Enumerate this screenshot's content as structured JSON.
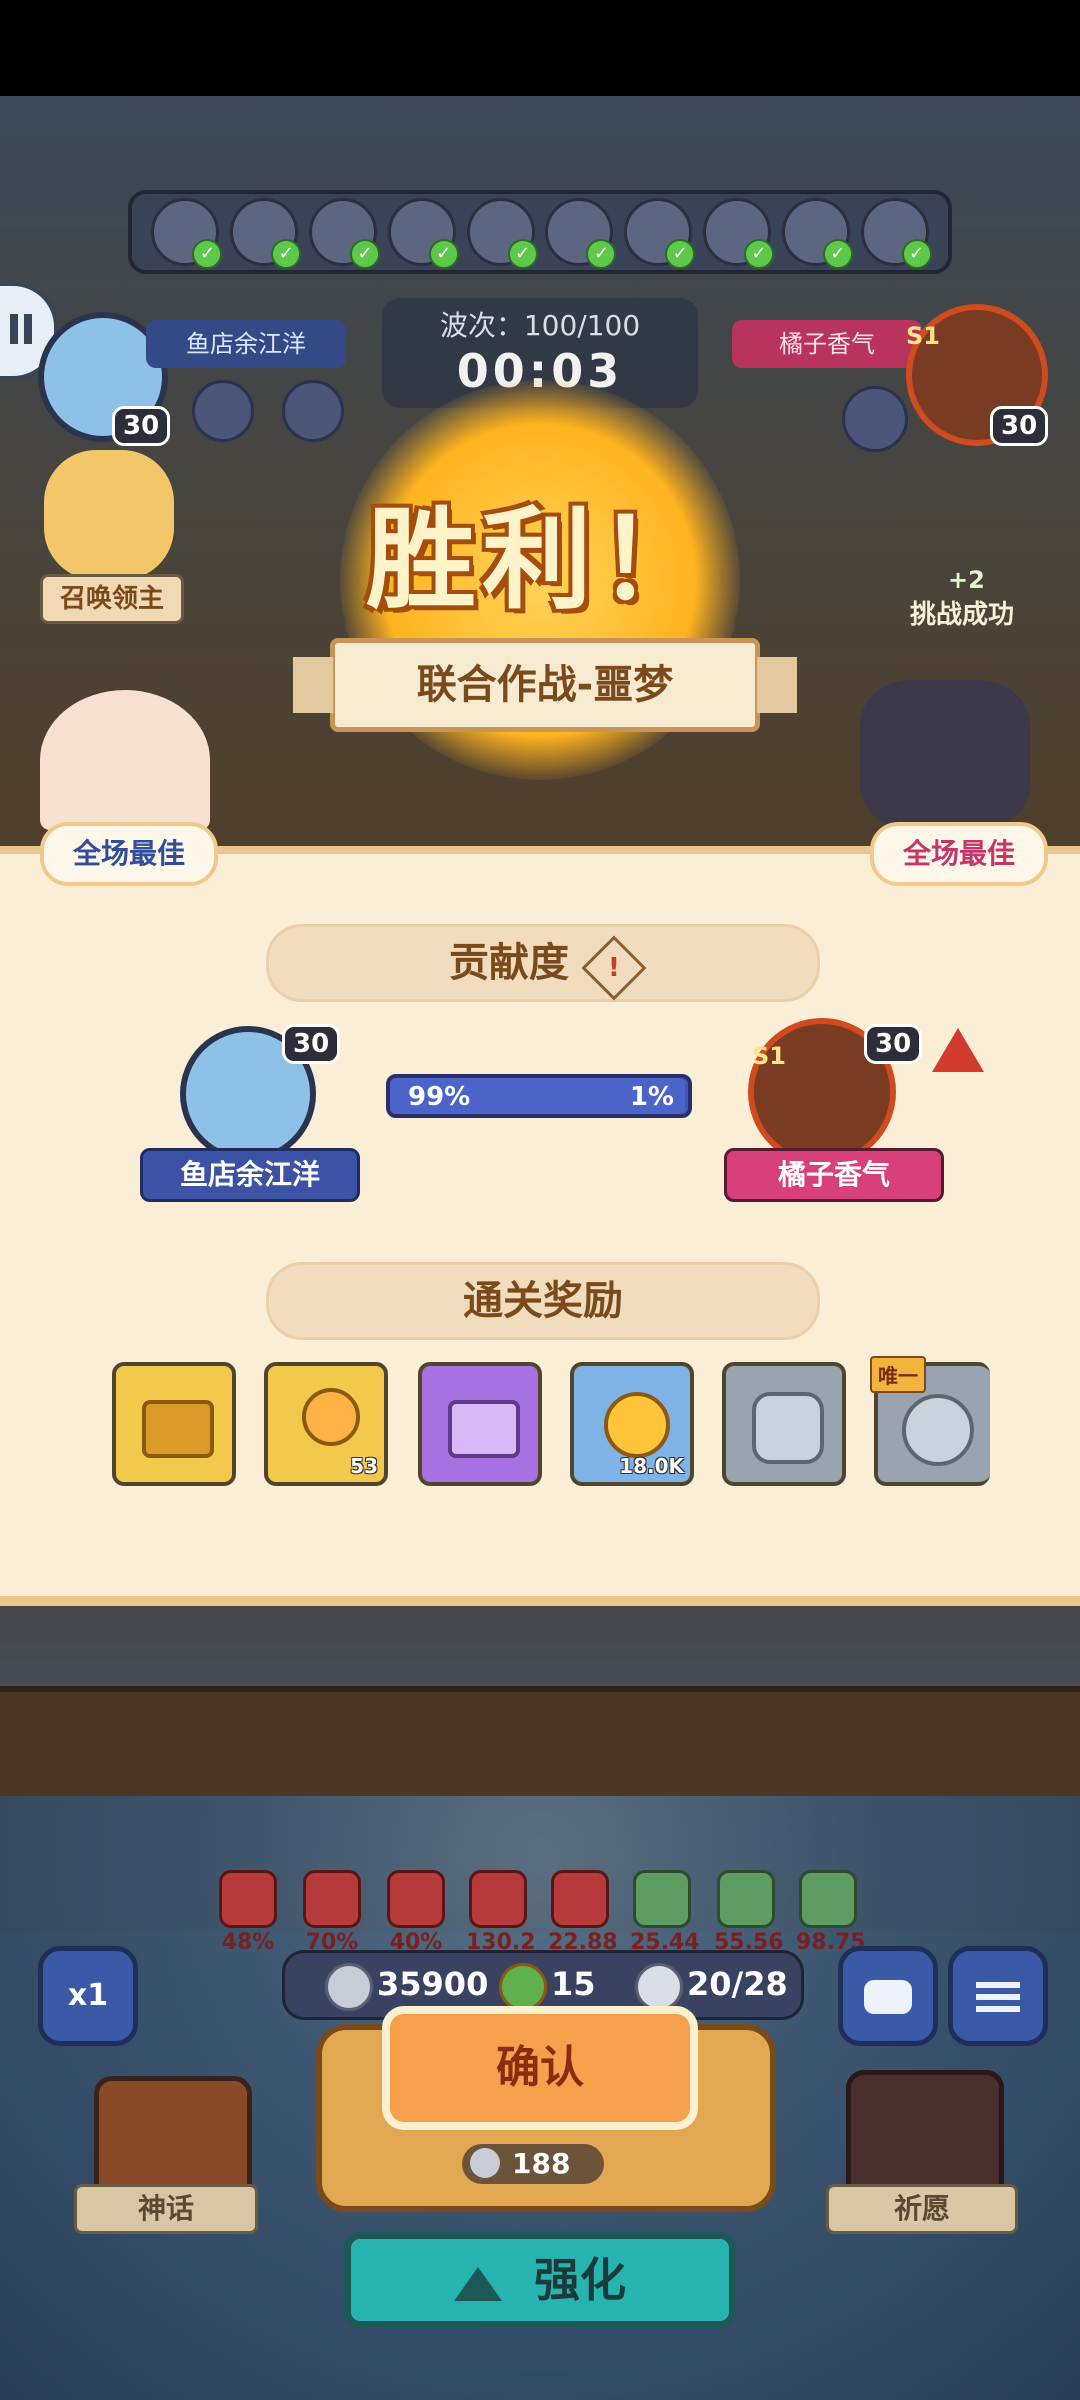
{
  "top": {
    "wave_label": "波次：100/100",
    "timer": "00:03",
    "player_left": {
      "name": "鱼店余江洋",
      "level": "30"
    },
    "player_right": {
      "name": "橘子香气",
      "level": "30",
      "season": "S1"
    },
    "summon_label": "召唤领主",
    "challenge": {
      "reward": "+2",
      "text": "挑战成功"
    },
    "hero_strip_count": 10
  },
  "victory": {
    "title": "胜利！",
    "mode": "联合作战-噩梦"
  },
  "panel": {
    "best_left": "全场最佳",
    "best_right": "全场最佳",
    "contribution_title": "贡献度",
    "contribution": {
      "left": {
        "name": "鱼店余江洋",
        "level": "30",
        "percent_label": "99%",
        "percent": 99
      },
      "right": {
        "name": "橘子香气",
        "level": "30",
        "season": "S1",
        "percent_label": "1%",
        "percent": 1
      }
    },
    "rewards_title": "通关奖励",
    "rewards": [
      {
        "item": "gold-chest",
        "color": "#f3c94b",
        "count": ""
      },
      {
        "item": "key",
        "color": "#f3c94b",
        "count": "53"
      },
      {
        "item": "purple-chest",
        "color": "#a671e0",
        "count": ""
      },
      {
        "item": "coin",
        "color": "#7fb2e5",
        "count": "18.0K"
      },
      {
        "item": "silver-emblem",
        "color": "#9aa4b1",
        "count": ""
      },
      {
        "item": "silver-badge",
        "color": "#9aa4b1",
        "count": "",
        "tag": "唯一"
      }
    ]
  },
  "hud": {
    "stats": [
      "48%",
      "70%",
      "40%",
      "130.2",
      "22.88",
      "25.44",
      "55.56",
      "98.75"
    ],
    "silver": "35900",
    "clover": "15",
    "units": "20/28",
    "speed": "x1",
    "confirm": "确认",
    "cost": "188",
    "myth": "神话",
    "wish": "祈愿",
    "enhance": "强化"
  }
}
